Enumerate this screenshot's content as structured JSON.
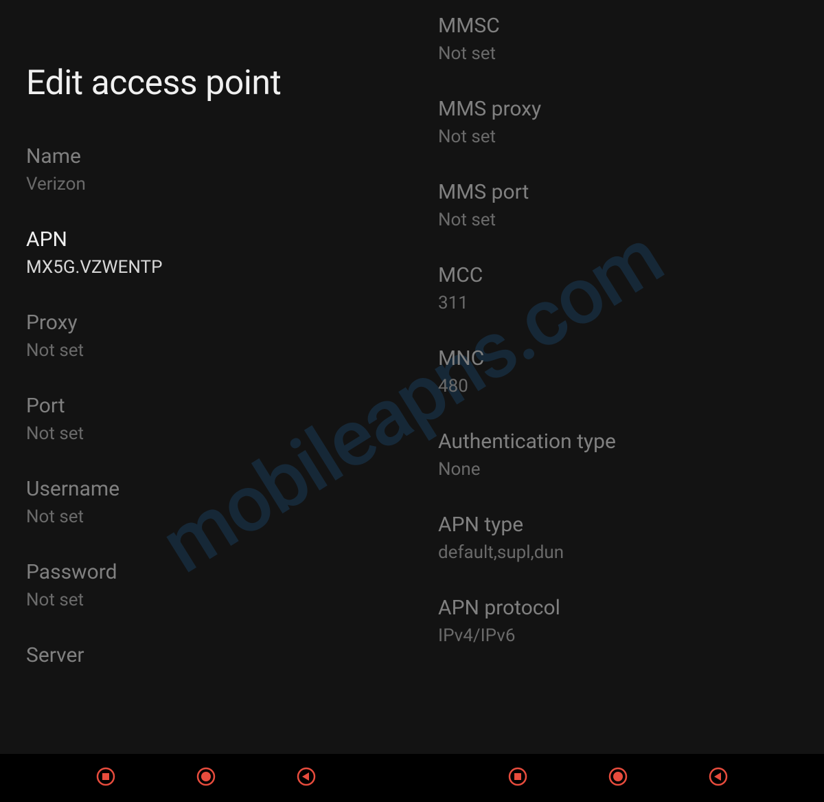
{
  "page": {
    "title": "Edit access point"
  },
  "watermark": "mobileapns.com",
  "left_settings": [
    {
      "label": "Name",
      "value": "Verizon",
      "highlighted": false
    },
    {
      "label": "APN",
      "value": "MX5G.VZWENTP",
      "highlighted": true
    },
    {
      "label": "Proxy",
      "value": "Not set",
      "highlighted": false
    },
    {
      "label": "Port",
      "value": "Not set",
      "highlighted": false
    },
    {
      "label": "Username",
      "value": "Not set",
      "highlighted": false
    },
    {
      "label": "Password",
      "value": "Not set",
      "highlighted": false
    },
    {
      "label": "Server",
      "value": "",
      "highlighted": false
    }
  ],
  "right_settings": [
    {
      "label": "MMSC",
      "value": "Not set",
      "highlighted": false
    },
    {
      "label": "MMS proxy",
      "value": "Not set",
      "highlighted": false
    },
    {
      "label": "MMS port",
      "value": "Not set",
      "highlighted": false
    },
    {
      "label": "MCC",
      "value": "311",
      "highlighted": false
    },
    {
      "label": "MNC",
      "value": "480",
      "highlighted": false
    },
    {
      "label": "Authentication type",
      "value": "None",
      "highlighted": false
    },
    {
      "label": "APN type",
      "value": "default,supl,dun",
      "highlighted": false
    },
    {
      "label": "APN protocol",
      "value": "IPv4/IPv6",
      "highlighted": false
    }
  ]
}
